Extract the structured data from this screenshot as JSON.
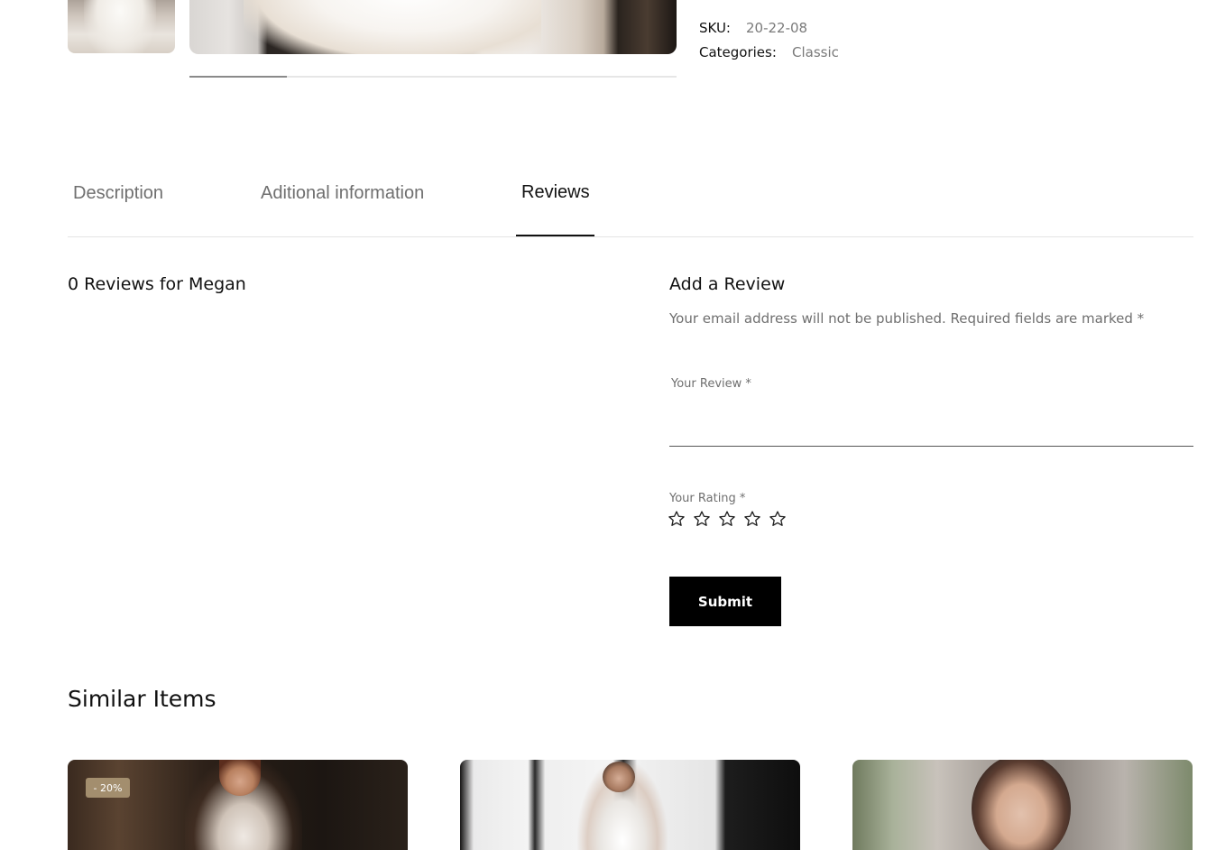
{
  "product_meta": {
    "sku_label": "SKU:",
    "sku_value": "20-22-08",
    "categories_label": "Categories:",
    "categories_value": "Classic"
  },
  "gallery": {
    "scroll_progress": 0.2
  },
  "tabs": [
    {
      "label": "Description",
      "active": false
    },
    {
      "label": "Aditional information",
      "active": false
    },
    {
      "label": "Reviews",
      "active": true
    }
  ],
  "reviews": {
    "count_heading": "0 Reviews for Megan"
  },
  "review_form": {
    "title": "Add a Review",
    "note": "Your email address will not be published. Required fields are marked *",
    "review_label": "Your Review *",
    "review_value": "",
    "rating_label": "Your Rating *",
    "rating_value": 0,
    "rating_max": 5,
    "submit_label": "Submit"
  },
  "similar": {
    "title": "Similar Items",
    "items": [
      {
        "badge": "- 20%"
      },
      {
        "badge": ""
      },
      {
        "badge": ""
      }
    ]
  },
  "icons": {
    "star": "star-outline-icon"
  },
  "colors": {
    "accent_badge": "#a38e6e",
    "button_bg": "#000000",
    "tab_active": "#111111",
    "tab_inactive": "#6f6f6f"
  }
}
